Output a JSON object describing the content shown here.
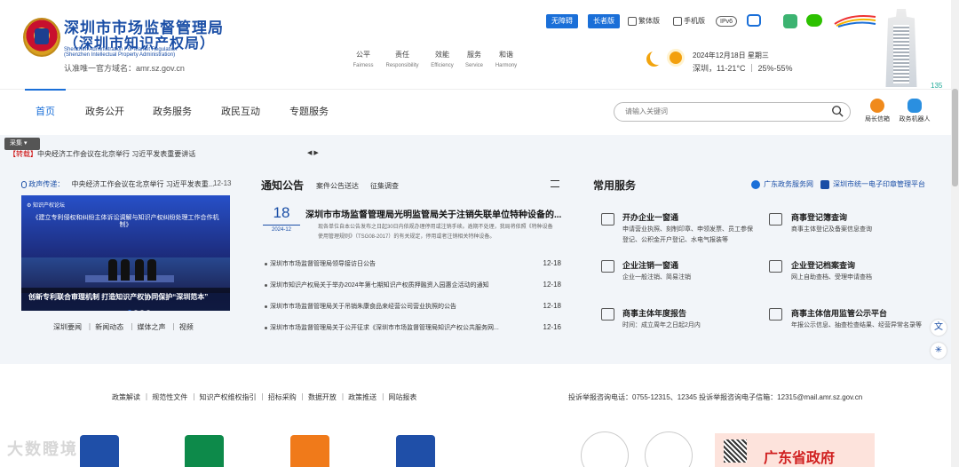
{
  "header": {
    "org_name_line1": "深圳市市场监督管理局",
    "org_name_line2": "（深圳市知识产权局）",
    "org_name_en1": "Shenzhen Administration For Market Regulation",
    "org_name_en2": "(Shenzhen Intellectual Property Administration)",
    "site_url": "认准唯一官方域名：amr.sz.gov.cn",
    "values": [
      {
        "cn": "公平",
        "en": "Fairness"
      },
      {
        "cn": "责任",
        "en": "Responsibility"
      },
      {
        "cn": "效能",
        "en": "Efficiency"
      },
      {
        "cn": "服务",
        "en": "Service"
      },
      {
        "cn": "和谐",
        "en": "Harmony"
      }
    ],
    "accessibility_btn": "无障碍",
    "elder_btn": "长者版",
    "traditional_label": "繁体版",
    "mobile_label": "手机版",
    "ipv6_label": "IPv6",
    "weather_date": "2024年12月18日 星期三",
    "weather_info": "深圳，11-21°C  ｜ 25%-55%",
    "corner_number": "135"
  },
  "nav": {
    "items": [
      "首页",
      "政务公开",
      "政务服务",
      "政民互动",
      "专题服务"
    ],
    "search_placeholder": "请输入关键词",
    "mayor_mail": "局长信箱",
    "robot": "政务机器人"
  },
  "ticker": {
    "collect_label": "采集",
    "tag": "【转载】",
    "text": "中央经济工作会议在北京举行 习近平发表重要讲话",
    "arrows": "◀ ▶"
  },
  "left_col": {
    "tag_label": "政声传递：",
    "headline": "中央经济工作会议在北京举行 习近平发表重...",
    "date": "12-13",
    "image_top_text": "《建立专利侵权和纠纷主体诉讼调解与知识产权纠纷处理工作合作机制》",
    "image_caption": "创新专利联合审理机制 打造知识产权协同保护“深圳范本”",
    "links": [
      "深圳要闻",
      "新闻动态",
      "媒体之声",
      "视频"
    ]
  },
  "notice": {
    "title": "通知公告",
    "tabs": [
      "案件公告送达",
      "征集调查"
    ],
    "featured": {
      "day": "18",
      "ym": "2024-12",
      "title": "深圳市市场监督管理局光明监管局关于注销失联单位特种设备的...",
      "desc": "现各单位自本公告发布之日起30日内依规办理停用或注销手续。逾期不处理，我局将依照《特种设备使用管理规则》（TSG08-2017）的有关规定，停用或者注销相关特种设备。"
    },
    "rows": [
      {
        "title": "深圳市市场监督管理局领导接访日公告",
        "date": "12-18"
      },
      {
        "title": "深圳市知识产权局关于举办2024年第七期知识产权质押融资入园惠企活动的通知",
        "date": "12-18"
      },
      {
        "title": "深圳市市场监督管理局关于吊销朱康食品来经营公司营业执照的公告",
        "date": "12-18"
      },
      {
        "title": "深圳市市场监督管理局关于公开征求《深圳市市场监督管理局知识产权公共服务网...",
        "date": "12-16"
      }
    ]
  },
  "services": {
    "title": "常用服务",
    "link1": "广东政务服务网",
    "link2": "深圳市统一电子印章管理平台",
    "items": [
      {
        "title": "开办企业一窗通",
        "desc": "申请营业执照、刻制印章、申领发票、员工参保登记、公积金开户登记、水电气报装等"
      },
      {
        "title": "商事登记簿查询",
        "desc": "商事主体登记及备案信息查询"
      },
      {
        "title": "企业注销一窗通",
        "desc": "企业一般注销、简易注销"
      },
      {
        "title": "企业登记档案查询",
        "desc": "网上自助查档、受理申请查档"
      },
      {
        "title": "商事主体年度报告",
        "desc": "时间：成立周年之日起2月内"
      },
      {
        "title": "商事主体信用监管公示平台",
        "desc": "年报公示信息、抽查检查结果、经营异常名录等"
      }
    ]
  },
  "footer": {
    "links": [
      "政策解读",
      "规范性文件",
      "知识产权维权指引",
      "招标采购",
      "数据开放",
      "政策推送",
      "网站报表"
    ],
    "contact": "投诉举报咨询电话：0755-12315、12345    投诉举报咨询电子信箱：12315@mail.amr.sz.gov.cn",
    "gd_banner": "广东省政府",
    "watermark": "大数瞪境"
  },
  "colors": {
    "brand_blue": "#1a4ea6",
    "accent_blue": "#1a6fd8",
    "alert_red": "#cc0000"
  }
}
